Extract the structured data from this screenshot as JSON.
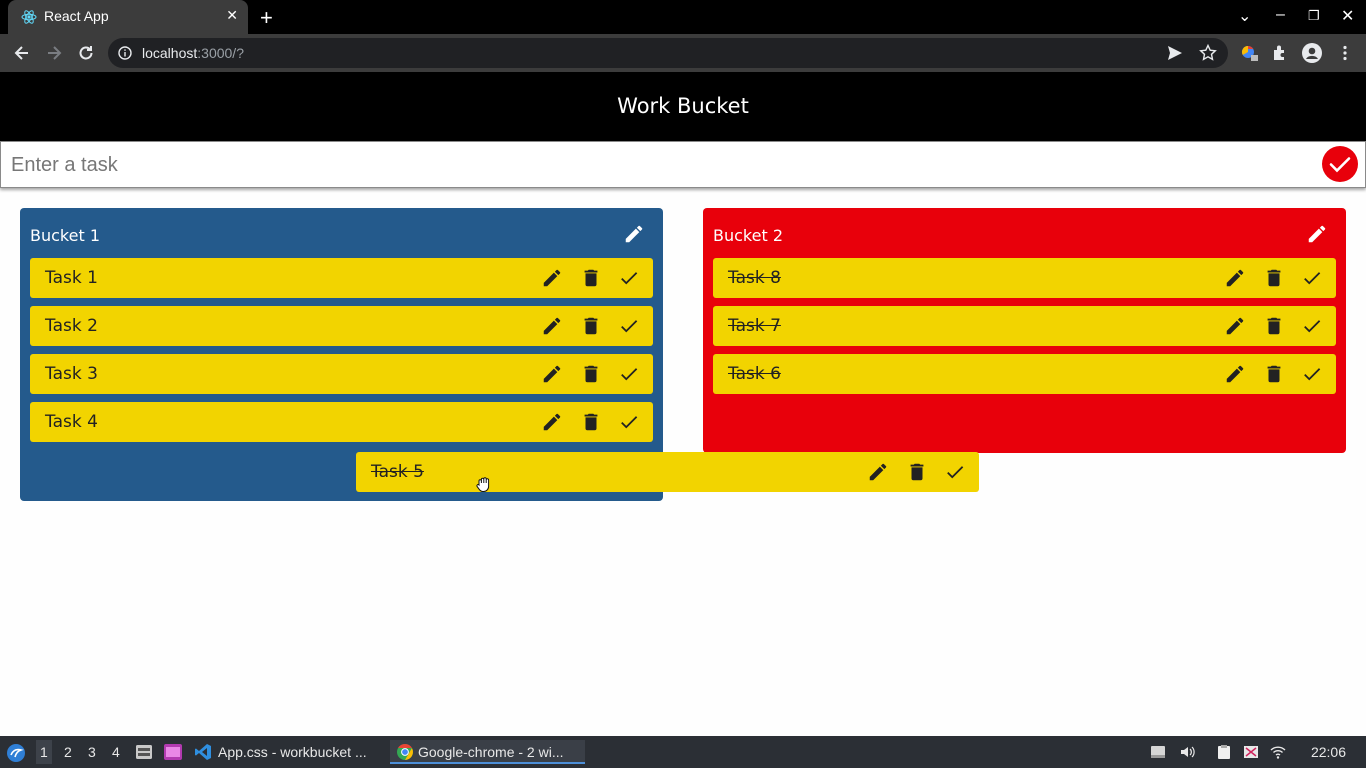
{
  "browser": {
    "tab_title": "React App",
    "url_host": "localhost",
    "url_rest": ":3000/?"
  },
  "app": {
    "title": "Work Bucket",
    "input_placeholder": "Enter a task",
    "colors": {
      "bucket1": "#245a8c",
      "bucket2": "#e8000b",
      "task": "#f2d400"
    }
  },
  "buckets": [
    {
      "title": "Bucket 1",
      "tasks": [
        {
          "label": "Task 1",
          "done": false
        },
        {
          "label": "Task 2",
          "done": false
        },
        {
          "label": "Task 3",
          "done": false
        },
        {
          "label": "Task 4",
          "done": false
        }
      ]
    },
    {
      "title": "Bucket 2",
      "tasks": [
        {
          "label": "Task 8",
          "done": true
        },
        {
          "label": "Task 7",
          "done": true
        },
        {
          "label": "Task 6",
          "done": true
        }
      ]
    }
  ],
  "dragging_task": {
    "label": "Task 5",
    "done": true
  },
  "taskbar": {
    "workspaces": [
      "1",
      "2",
      "3",
      "4"
    ],
    "apps": [
      {
        "label": "App.css - workbucket ...",
        "icon": "vscode-icon"
      },
      {
        "label": "Google-chrome - 2 wi...",
        "icon": "chrome-icon"
      }
    ],
    "clock": "22:06"
  }
}
